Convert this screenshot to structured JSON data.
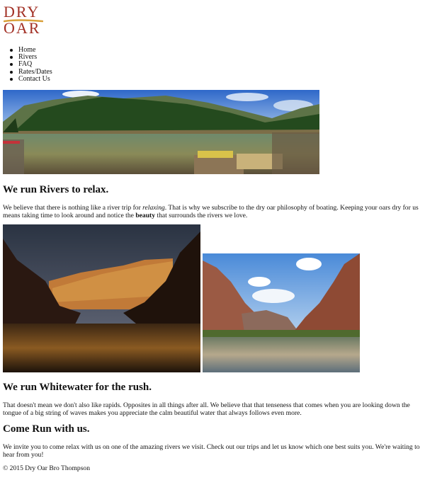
{
  "logo": {
    "line1": "DRY",
    "line2": "OAR",
    "color": "#a23025",
    "accent": "#d9a13b"
  },
  "nav": {
    "items": [
      {
        "label": "Home"
      },
      {
        "label": "Rivers"
      },
      {
        "label": "FAQ"
      },
      {
        "label": "Rates/Dates"
      },
      {
        "label": "Contact Us"
      }
    ]
  },
  "sections": {
    "relax": {
      "heading": "We run Rivers to relax.",
      "text_before_em": "We believe that there is nothing like a river trip for ",
      "em": "relaxing",
      "text_mid": ". That is why we subscribe to the dry oar philosophy of boating. Keeping your oars dry for us means taking time to look around and notice the ",
      "strong": "beauty",
      "text_after": " that surrounds the rivers we love."
    },
    "whitewater": {
      "heading": "We run Whitewater for the rush.",
      "text": "That doesn't mean we don't also like rapids. Opposites in all things after all. We believe that that tenseness that comes when you are looking down the tongue of a big string of waves makes you appreciate the calm beautiful water that always follows even more."
    },
    "come": {
      "heading": "Come Run with us.",
      "text": "We invite you to come relax with us on one of the amazing rivers we visit. Check out our trips and let us know which one best suits you. We're waiting to hear from you!"
    }
  },
  "footer": {
    "text": "© 2015 Dry Oar Bro Thompson"
  }
}
